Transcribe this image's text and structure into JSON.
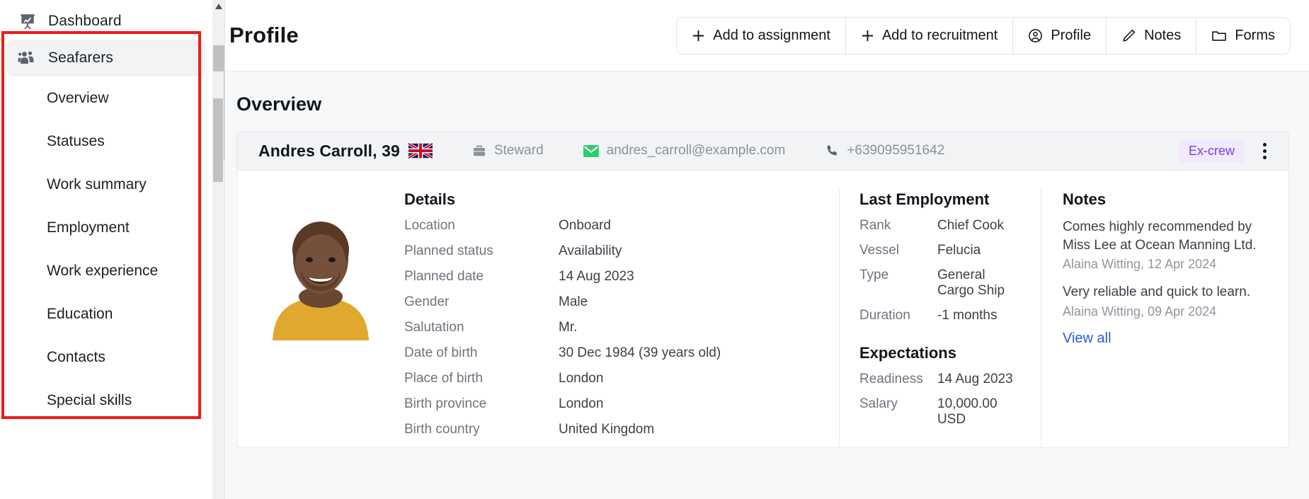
{
  "sidebar": {
    "items": [
      {
        "label": "Dashboard",
        "icon": "dashboard-icon",
        "type": "top",
        "active": false
      },
      {
        "label": "Seafarers",
        "icon": "people-icon",
        "type": "top",
        "active": true
      },
      {
        "label": "Overview",
        "type": "sub"
      },
      {
        "label": "Statuses",
        "type": "sub"
      },
      {
        "label": "Work summary",
        "type": "sub"
      },
      {
        "label": "Employment",
        "type": "sub"
      },
      {
        "label": "Work experience",
        "type": "sub"
      },
      {
        "label": "Education",
        "type": "sub"
      },
      {
        "label": "Contacts",
        "type": "sub"
      },
      {
        "label": "Special skills",
        "type": "sub"
      }
    ],
    "highlight_color": "#ef1a1a"
  },
  "topbar": {
    "title": "Profile",
    "buttons": [
      {
        "label": "Add to assignment",
        "icon": "plus-icon"
      },
      {
        "label": "Add to recruitment",
        "icon": "plus-icon"
      },
      {
        "label": "Profile",
        "icon": "user-circle-icon"
      },
      {
        "label": "Notes",
        "icon": "pencil-icon"
      },
      {
        "label": "Forms",
        "icon": "folder-icon"
      }
    ]
  },
  "content": {
    "section_title": "Overview",
    "profile": {
      "name_age": "Andres Carroll, 39",
      "flag": "united-kingdom-flag",
      "role": "Steward",
      "email": "andres_carroll@example.com",
      "phone": "+639095951642",
      "badge": "Ex-crew",
      "badge_bg": "#f1e9fd",
      "badge_color": "#7a3fd4",
      "avatar": "seafarer-photo"
    },
    "details": {
      "heading": "Details",
      "rows": [
        {
          "label": "Location",
          "value": "Onboard"
        },
        {
          "label": "Planned status",
          "value": "Availability"
        },
        {
          "label": "Planned date",
          "value": "14 Aug 2023"
        },
        {
          "label": "Gender",
          "value": "Male"
        },
        {
          "label": "Salutation",
          "value": "Mr."
        },
        {
          "label": "Date of birth",
          "value": "30 Dec 1984 (39 years old)"
        },
        {
          "label": "Place of birth",
          "value": "London"
        },
        {
          "label": "Birth province",
          "value": "London"
        },
        {
          "label": "Birth country",
          "value": "United Kingdom"
        }
      ]
    },
    "last_employment": {
      "heading": "Last Employment",
      "rows": [
        {
          "label": "Rank",
          "value": "Chief Cook"
        },
        {
          "label": "Vessel",
          "value": "Felucia"
        },
        {
          "label": "Type",
          "value": "General Cargo Ship"
        },
        {
          "label": "Duration",
          "value": "-1 months"
        }
      ]
    },
    "expectations": {
      "heading": "Expectations",
      "rows": [
        {
          "label": "Readiness",
          "value": "14 Aug 2023"
        },
        {
          "label": "Salary",
          "value": "10,000.00 USD"
        }
      ]
    },
    "notes": {
      "heading": "Notes",
      "items": [
        {
          "text": "Comes highly recommended by Miss Lee at Ocean Manning Ltd.",
          "by": "Alaina Witting, 12 Apr 2024"
        },
        {
          "text": "Very reliable and quick to learn.",
          "by": "Alaina Witting, 09 Apr 2024"
        }
      ],
      "view_all": "View all",
      "link_color": "#2a5bd7"
    }
  }
}
